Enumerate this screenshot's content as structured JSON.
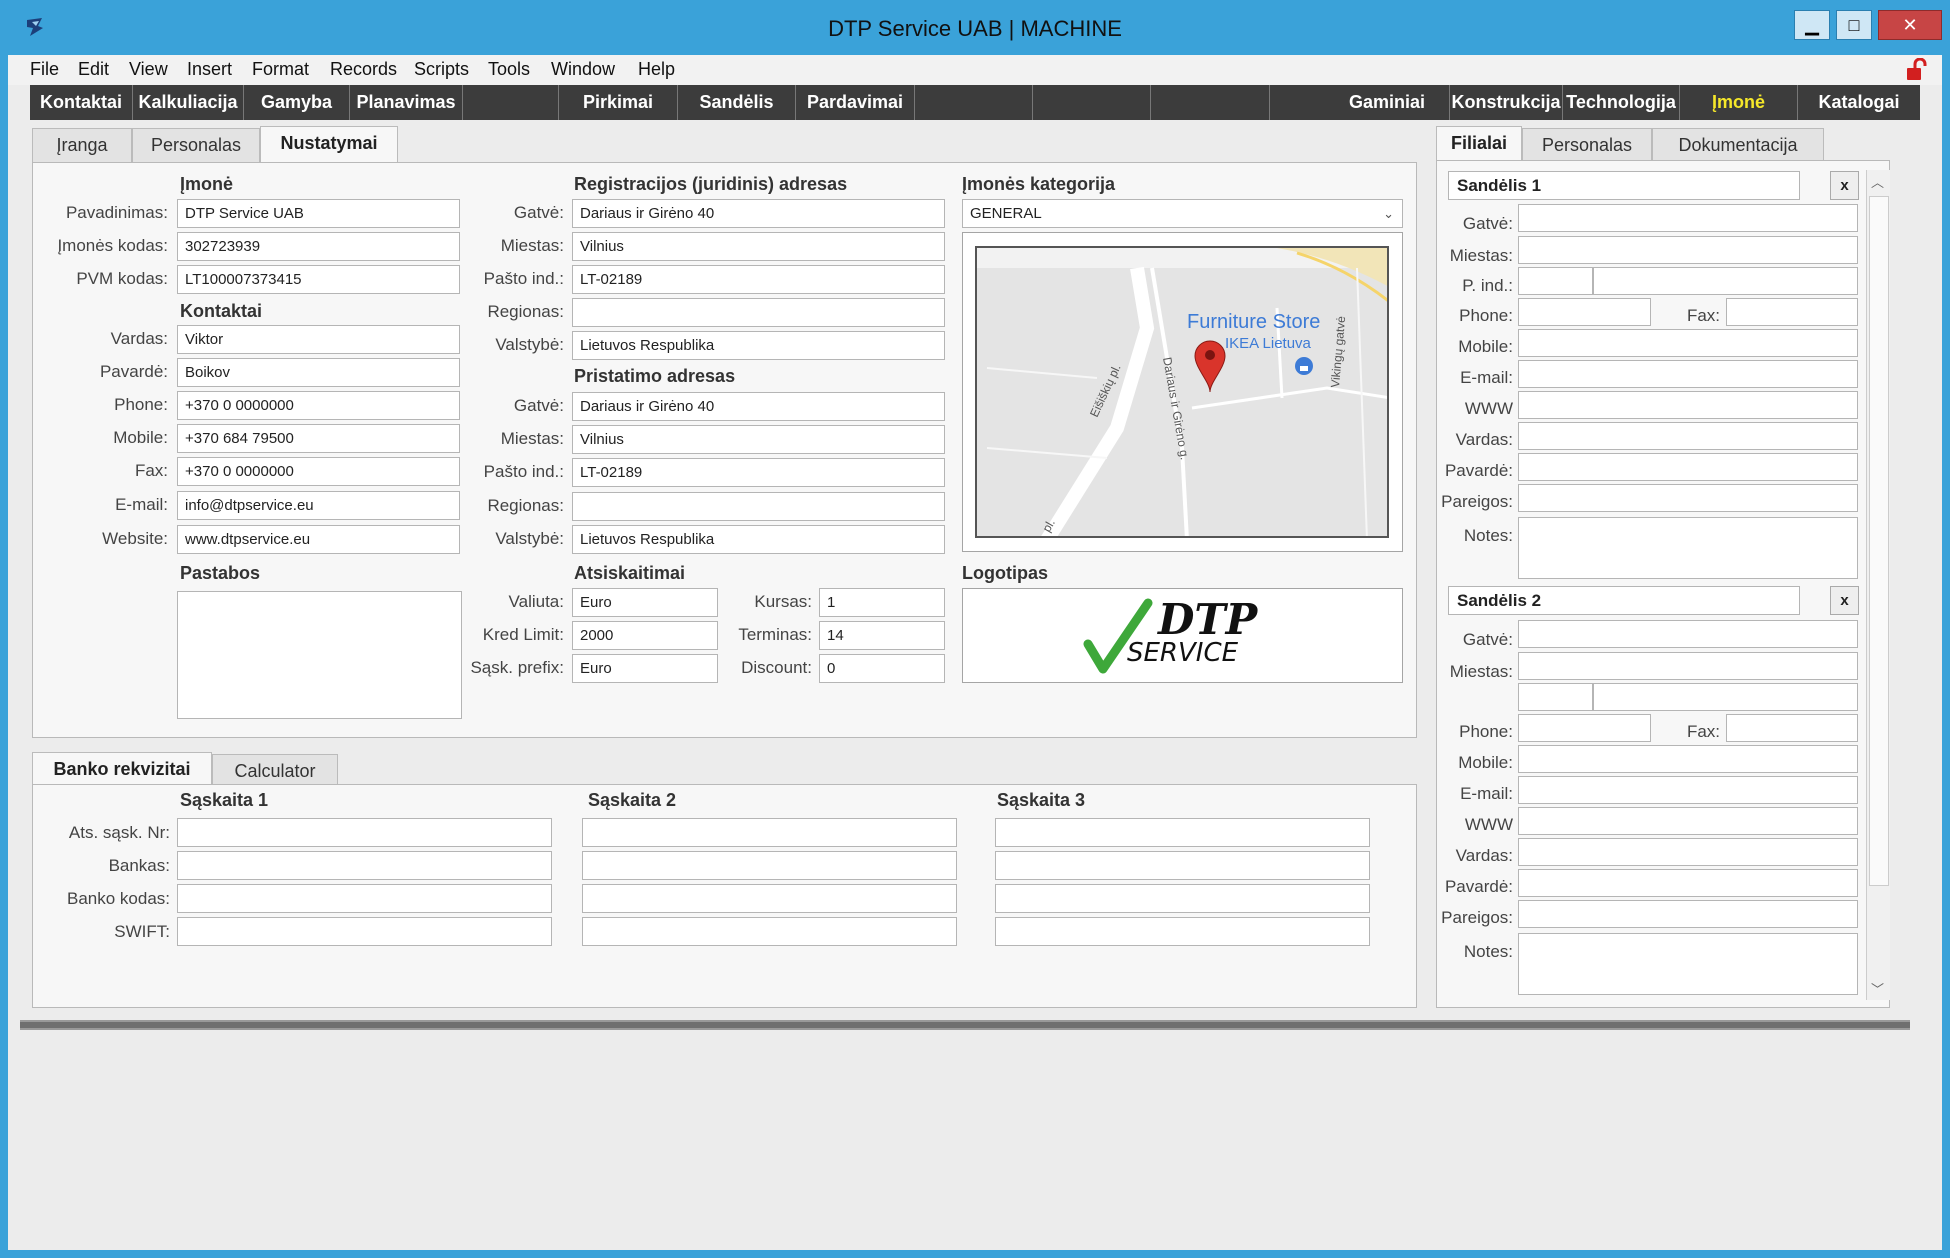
{
  "window": {
    "title": "DTP Service UAB | MACHINE"
  },
  "menu": [
    "File",
    "Edit",
    "View",
    "Insert",
    "Format",
    "Records",
    "Scripts",
    "Tools",
    "Window",
    "Help"
  ],
  "modules": [
    "Kontaktai",
    "Kalkuliacija",
    "Gamyba",
    "Planavimas",
    "",
    "Pirkimai",
    "Sandėlis",
    "Pardavimai",
    "",
    "",
    "",
    "Gaminiai",
    "Konstrukcija",
    "Technologija",
    "Įmonė",
    "Katalogai"
  ],
  "active_module": "Įmonė",
  "top_tabs": [
    "Įranga",
    "Personalas",
    "Nustatymai"
  ],
  "company": {
    "title": "Įmonė",
    "name_label": "Pavadinimas:",
    "name": "DTP Service UAB",
    "code_label": "Įmonės kodas:",
    "code": "302723939",
    "vat_label": "PVM kodas:",
    "vat": "LT100007373415"
  },
  "contacts": {
    "title": "Kontaktai",
    "first_label": "Vardas:",
    "first": "Viktor",
    "last_label": "Pavardė:",
    "last": "Boikov",
    "phone_label": "Phone:",
    "phone": "+370 0 0000000",
    "mobile_label": "Mobile:",
    "mobile": "+370 684 79500",
    "fax_label": "Fax:",
    "fax": "+370 0 0000000",
    "email_label": "E-mail:",
    "email": "info@dtpservice.eu",
    "web_label": "Website:",
    "web": "www.dtpservice.eu"
  },
  "notes_title": "Pastabos",
  "reg_address": {
    "title": "Registracijos (juridinis) adresas",
    "street_label": "Gatvė:",
    "street": "Dariaus ir Girėno 40",
    "city_label": "Miestas:",
    "city": "Vilnius",
    "zip_label": "Pašto ind.:",
    "zip": "LT-02189",
    "region_label": "Regionas:",
    "region": "",
    "country_label": "Valstybė:",
    "country": "Lietuvos Respublika"
  },
  "delivery_address": {
    "title": "Pristatimo adresas",
    "street_label": "Gatvė:",
    "street": "Dariaus ir Girėno 40",
    "city_label": "Miestas:",
    "city": "Vilnius",
    "zip_label": "Pašto ind.:",
    "zip": "LT-02189",
    "region_label": "Regionas:",
    "region": "",
    "country_label": "Valstybė:",
    "country": "Lietuvos Respublika"
  },
  "settlements": {
    "title": "Atsiskaitimai",
    "currency_label": "Valiuta:",
    "currency": "Euro",
    "rate_label": "Kursas:",
    "rate": "1",
    "credit_label": "Kred Limit:",
    "credit": "2000",
    "term_label": "Terminas:",
    "term": "14",
    "prefix_label": "Sąsk. prefix:",
    "prefix": "Euro",
    "discount_label": "Discount:",
    "discount": "0"
  },
  "category": {
    "title": "Įmonės kategorija",
    "value": "GENERAL"
  },
  "map": {
    "store_title": "Furniture Store",
    "store_sub": "IKEA Lietuva",
    "road1": "Eišiškių pl.",
    "road2": "Dariaus ir Girėno g.",
    "road3": "Vikingų gatvė",
    "road4": "pl."
  },
  "logo": {
    "title": "Logotipas",
    "line1": "DTP",
    "line2": "SERVICE"
  },
  "bank_tabs": [
    "Banko rekvizitai",
    "Calculator"
  ],
  "bank": {
    "labels": [
      "Ats. sąsk. Nr:",
      "Bankas:",
      "Banko kodas:",
      "SWIFT:"
    ],
    "accounts": [
      "Sąskaita 1",
      "Sąskaita 2",
      "Sąskaita 3"
    ]
  },
  "right_tabs": [
    "Filialai",
    "Personalas",
    "Dokumentacija"
  ],
  "warehouses": [
    {
      "name": "Sandėlis 1"
    },
    {
      "name": "Sandėlis 2"
    }
  ],
  "wh_labels": {
    "street": "Gatvė:",
    "city": "Miestas:",
    "zip": "P. ind.:",
    "phone": "Phone:",
    "fax": "Fax:",
    "mobile": "Mobile:",
    "email": "E-mail:",
    "www": "WWW",
    "first": "Vardas:",
    "last": "Pavardė:",
    "position": "Pareigos:",
    "notes": "Notes:"
  },
  "close_label": "x"
}
